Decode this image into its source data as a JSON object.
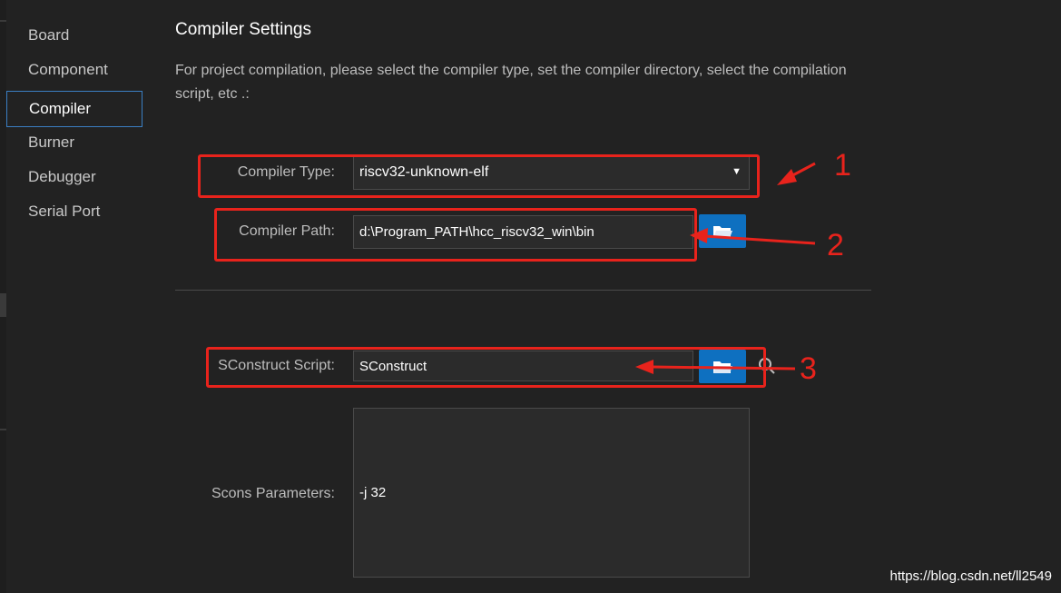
{
  "sidebar": {
    "items": [
      {
        "label": "Board"
      },
      {
        "label": "Component"
      },
      {
        "label": "Compiler"
      },
      {
        "label": "Burner"
      },
      {
        "label": "Debugger"
      },
      {
        "label": "Serial Port"
      }
    ],
    "active": "Compiler"
  },
  "main": {
    "title": "Compiler Settings",
    "description": "For project compilation, please select the compiler type, set the compiler directory, select the compilation script, etc .:",
    "compiler_type": {
      "label": "Compiler Type:",
      "value": "riscv32-unknown-elf"
    },
    "compiler_path": {
      "label": "Compiler Path:",
      "value": "d:\\Program_PATH\\hcc_riscv32_win\\bin"
    },
    "sconstruct": {
      "label": "SConstruct Script:",
      "value": "SConstruct"
    },
    "scons_params": {
      "label": "Scons Parameters:",
      "value": "-j 32"
    }
  },
  "annotations": [
    "1",
    "2",
    "3"
  ],
  "watermark": "https://blog.csdn.net/ll2549",
  "colors": {
    "accent": "#0e70c0",
    "annotation_red": "#e8231c",
    "active_border": "#3b7fc4"
  },
  "icons": [
    "folder-open-icon",
    "search-icon",
    "chevron-down-icon"
  ]
}
